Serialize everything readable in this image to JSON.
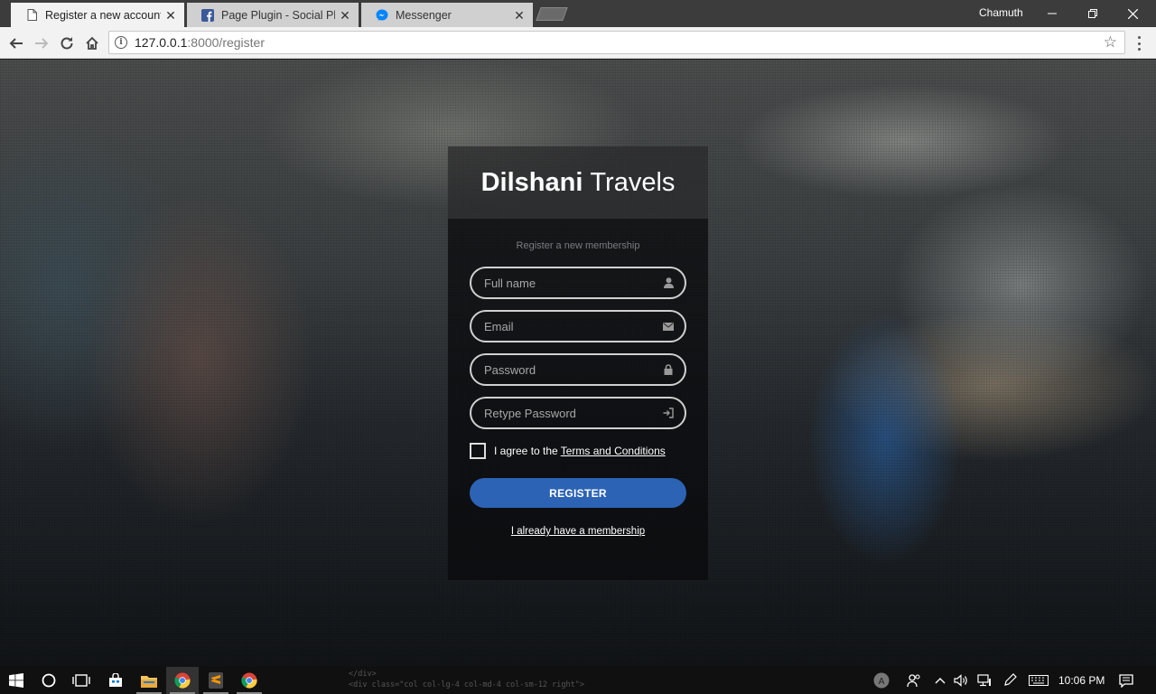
{
  "browser": {
    "tabs": [
      {
        "title": "Register a new account |",
        "active": true,
        "icon": "document-icon"
      },
      {
        "title": "Page Plugin - Social Plug",
        "active": false,
        "icon": "facebook-icon"
      },
      {
        "title": "Messenger",
        "active": false,
        "icon": "messenger-icon"
      }
    ],
    "profile_name": "Chamuth",
    "url_host": "127.0.0.1",
    "url_path": ":8000/register"
  },
  "card": {
    "brand_bold": "Dilshani",
    "brand_light": "Travels",
    "subtitle": "Register a new membership",
    "fields": {
      "full_name_placeholder": "Full name",
      "email_placeholder": "Email",
      "password_placeholder": "Password",
      "retype_placeholder": "Retype Password"
    },
    "agree_text": "I agree to the",
    "terms_link": "Terms and Conditions",
    "register_button": "REGISTER",
    "login_link": "I already have a membership"
  },
  "taskbar": {
    "time": "10:06 PM",
    "code_peek": [
      "</div>",
      "<div class=\"col col-lg-4 col-md-4 col-sm-12 right\">"
    ]
  },
  "colors": {
    "accent": "#2c63b4",
    "chrome_frame": "#3c3c3c",
    "taskbar": "#101010"
  }
}
